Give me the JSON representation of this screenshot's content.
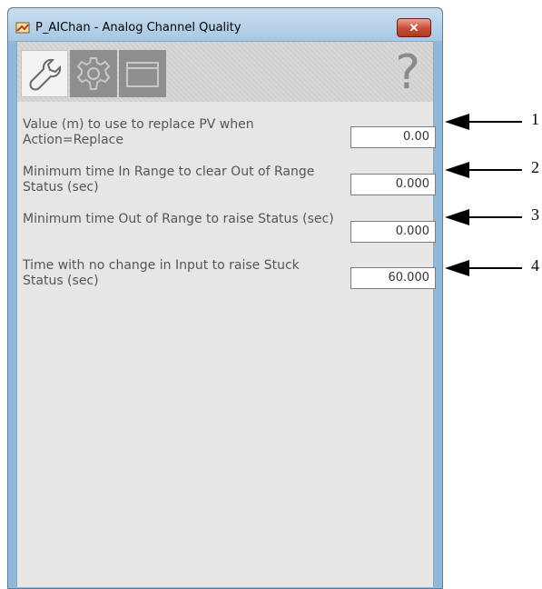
{
  "window": {
    "title": "P_AIChan - Analog Channel Quality",
    "close_glyph": "✕"
  },
  "tabs": [
    {
      "name": "wrench-icon",
      "selected": true
    },
    {
      "name": "gear-icon",
      "selected": false
    },
    {
      "name": "window-icon",
      "selected": false
    }
  ],
  "help_glyph": "?",
  "settings": [
    {
      "label": "Value (m) to use to replace PV when Action=Replace",
      "value": "0.00"
    },
    {
      "label": "Minimum time In Range to clear Out of Range Status (sec)",
      "value": "0.000"
    },
    {
      "label": "Minimum time Out of Range to raise Status (sec)",
      "value": "0.000"
    },
    {
      "label": "Time with no change in Input to raise Stuck Status (sec)",
      "value": "60.000"
    }
  ],
  "callouts": [
    "1",
    "2",
    "3",
    "4"
  ]
}
